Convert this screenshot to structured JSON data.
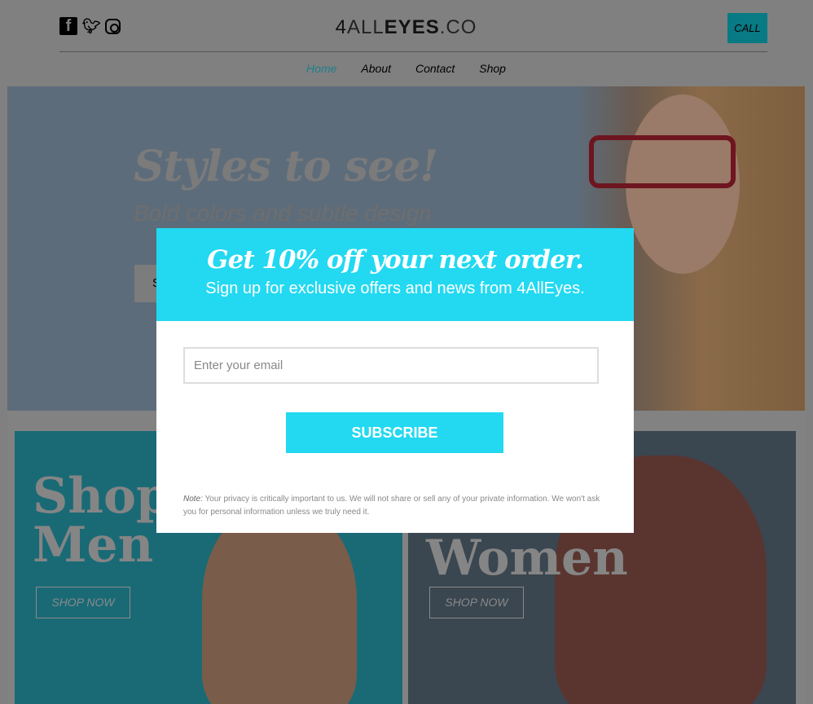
{
  "header": {
    "logo": {
      "a": "4",
      "b": "ALL",
      "c": "EYES",
      "d": ".CO"
    },
    "call_label": "CALL",
    "social": [
      "facebook-icon",
      "twitter-icon",
      "instagram-icon"
    ]
  },
  "nav": {
    "items": [
      {
        "label": "Home",
        "active": true
      },
      {
        "label": "About"
      },
      {
        "label": "Contact"
      },
      {
        "label": "Shop"
      }
    ]
  },
  "hero": {
    "title": "Styles to see!",
    "subtitle": "Bold colors and subtle design",
    "button_label": "S"
  },
  "cards": [
    {
      "title_line1": "Shop",
      "title_line2": "Men",
      "button": "SHOP NOW"
    },
    {
      "title_line1": "",
      "title_line2": "Women",
      "button": "SHOP NOW"
    }
  ],
  "modal": {
    "headline": "Get 10% off your next order.",
    "subheadline": "Sign up for exclusive offers and news from 4AllEyes.",
    "email_placeholder": "Enter your email",
    "email_value": "",
    "subscribe_label": "SUBSCRIBE",
    "note_label": "Note:",
    "note_text": " Your privacy is critically important to us. We will not share or sell any of your private information. We won't ask you for personal information unless we truly need it.",
    "accent": "#22d9f1"
  }
}
